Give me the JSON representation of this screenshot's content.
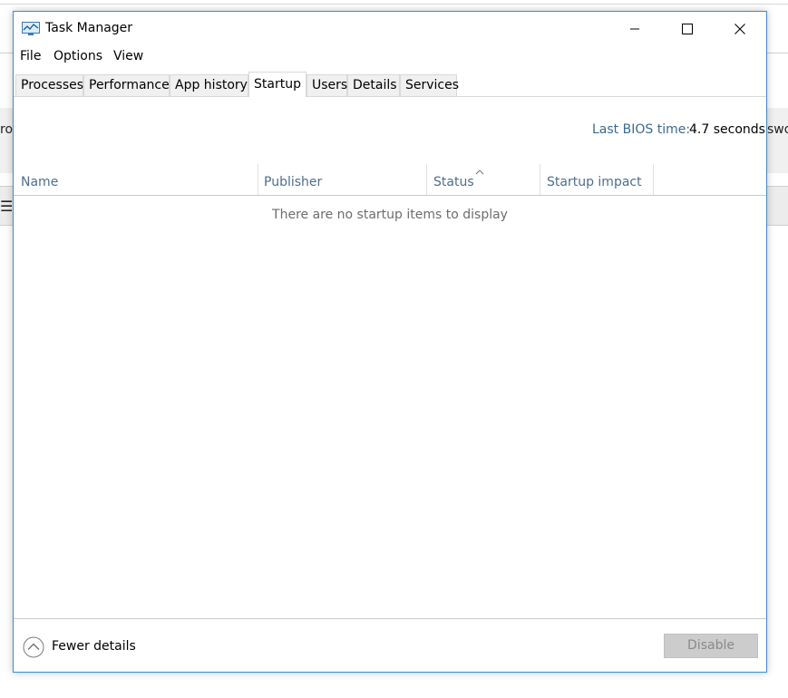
{
  "background": {
    "left_text": "ro",
    "right_text": "swo",
    "menu_glyph": "☰"
  },
  "window": {
    "title": "Task Manager",
    "icon": "task-manager-icon",
    "controls": {
      "minimize_icon": "minimize-icon",
      "maximize_icon": "maximize-icon",
      "close_icon": "close-icon"
    }
  },
  "menu": {
    "items": [
      "File",
      "Options",
      "View"
    ]
  },
  "tabs": {
    "items": [
      "Processes",
      "Performance",
      "App history",
      "Startup",
      "Users",
      "Details",
      "Services"
    ],
    "active": "Startup"
  },
  "startup": {
    "bios_label": "Last BIOS time:",
    "bios_value": "4.7 seconds",
    "columns": [
      "Name",
      "Publisher",
      "Status",
      "Startup impact"
    ],
    "sorted_column": "Status",
    "empty_message": "There are no startup items to display"
  },
  "footer": {
    "fewer_details_label": "Fewer details",
    "disable_label": "Disable"
  },
  "colors": {
    "window_border": "#3c8fd1",
    "header_text": "#4d6f8c",
    "bios_label": "#3a6a8f",
    "disabled_button": "#cccccc"
  }
}
